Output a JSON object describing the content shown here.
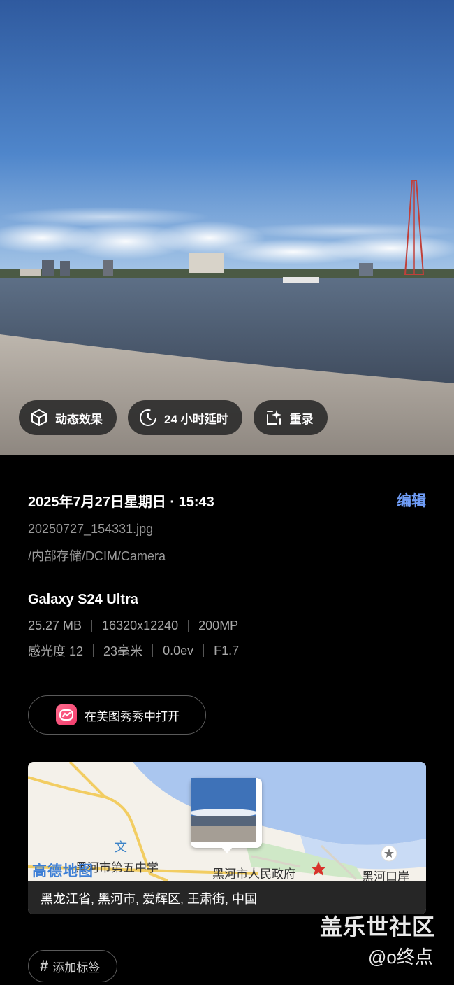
{
  "photo_actions": [
    {
      "label": "动态效果",
      "icon": "cube-icon"
    },
    {
      "label": "24 小时延时",
      "icon": "clock-timelapse-icon"
    },
    {
      "label": "重录",
      "icon": "sparkle-frame-icon"
    }
  ],
  "details": {
    "datetime": "2025年7月27日星期日 · 15:43",
    "edit_label": "编辑",
    "filename": "20250727_154331.jpg",
    "path": "/内部存储/DCIM/Camera"
  },
  "device": {
    "model": "Galaxy S24 Ultra",
    "specs_row1": [
      "25.27 MB",
      "16320x12240",
      "200MP"
    ],
    "specs_row2": [
      "感光度 12",
      "23毫米",
      "0.0ev",
      "F1.7"
    ]
  },
  "open_with": {
    "label": "在美图秀秀中打开",
    "icon": "meitu-app-icon"
  },
  "map": {
    "provider": "高德地图",
    "labels": {
      "school": "黑河市第五中学",
      "government": "黑河市人民政府",
      "port": "黑河口岸",
      "culture": "文"
    },
    "address": "黑龙江省, 黑河市, 爱辉区, 王肃街, 中国"
  },
  "tags": {
    "add_label": "添加标签",
    "hash": "#"
  },
  "watermark": {
    "line1": "盖乐世社区",
    "line2": "@o终点"
  },
  "colors": {
    "accent": "#6f9cf5",
    "background": "#000000"
  }
}
